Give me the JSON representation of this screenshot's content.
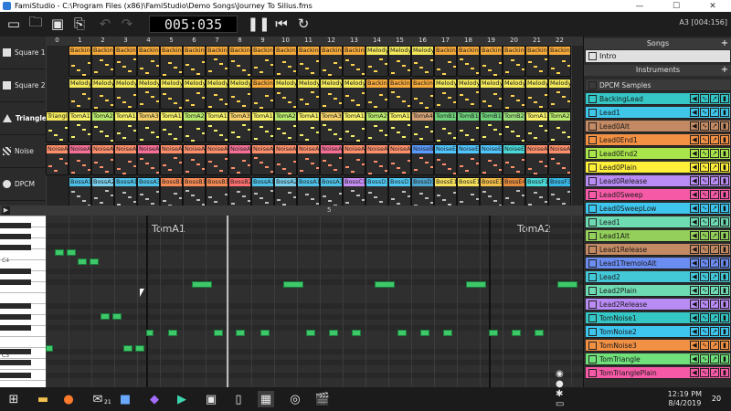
{
  "window": {
    "title": "FamiStudio - C:\\Program Files (x86)\\FamiStudio\\Demo Songs\\Journey To Silius.fms",
    "minimize": "—",
    "maximize": "☐",
    "close": "✕"
  },
  "toolbar": {
    "timecode": "005:035",
    "status": "A3 [004:156]"
  },
  "channels": [
    {
      "label": "Square 1",
      "icon": "square-wave-icon"
    },
    {
      "label": "Square 2",
      "icon": "square-wave-icon"
    },
    {
      "label": "Triangle",
      "icon": "triangle-wave-icon",
      "active": true
    },
    {
      "label": "Noise",
      "icon": "noise-icon"
    },
    {
      "label": "DPCM",
      "icon": "dpcm-icon"
    }
  ],
  "seq_numbers": [
    "0",
    "1",
    "2",
    "3",
    "4",
    "5",
    "6",
    "7",
    "8",
    "9",
    "10",
    "11",
    "12",
    "13",
    "14",
    "15",
    "16",
    "17",
    "18",
    "19",
    "20",
    "21",
    "22"
  ],
  "sequencer": {
    "square1": [
      "",
      "Backing",
      "Backing",
      "Backing",
      "Backing",
      "Backing",
      "Backing",
      "Backing",
      "Backing",
      "Backing",
      "Backing",
      "Backing",
      "Backing",
      "Backing",
      "Melody",
      "Melody",
      "Melody",
      "Backing",
      "Backing",
      "Backing",
      "Backing",
      "Backing",
      "Backing"
    ],
    "square2": [
      "",
      "Melody",
      "Melody",
      "Melody",
      "Melody",
      "Melody",
      "Melody",
      "Melody",
      "Melody",
      "Backing",
      "Melody",
      "Melody",
      "Melody",
      "Melody",
      "Backing",
      "Backing",
      "Backing",
      "Melody",
      "Melody",
      "Melody",
      "Melody",
      "Melody",
      "Melody"
    ],
    "triangle": [
      "Triangle",
      "TomA1",
      "TomA2",
      "TomA1",
      "TomA3",
      "TomA1",
      "TomA2",
      "TomA1",
      "TomA3",
      "TomA1",
      "TomA2",
      "TomA1",
      "TomA3",
      "TomA1",
      "TomA2",
      "TomA1",
      "TomA4",
      "TomB1",
      "TomB1",
      "TomB1",
      "TomB2",
      "TomA1",
      "TomA2"
    ],
    "noise": [
      "NoiseA1",
      "NoiseA2",
      "NoiseA1",
      "NoiseA1",
      "NoiseA2",
      "NoiseA1",
      "NoiseA1",
      "NoiseA1",
      "NoiseA2",
      "NoiseA1",
      "NoiseA1",
      "NoiseA1",
      "NoiseA2",
      "NoiseA1",
      "NoiseA1",
      "NoiseA1",
      "NoiseB1",
      "NoiseE1",
      "NoiseE1",
      "NoiseE1",
      "NoiseE2",
      "NoiseA1",
      "NoiseA1"
    ],
    "dpcm": [
      "",
      "BossA1",
      "BossA2",
      "BossA1",
      "BossA3",
      "BossB1",
      "BossB1",
      "BossB1",
      "BossB2",
      "BossA1",
      "BossA2",
      "BossA1",
      "BossA3",
      "BossC1",
      "BossD1",
      "BossD1",
      "BossD3",
      "BossE1",
      "BossE1",
      "BossE3",
      "BossE4",
      "BossF1",
      "BossF3"
    ]
  },
  "scroll_marker": "5",
  "piano": {
    "label_c4": "C4",
    "label_c3": "C3"
  },
  "roll": {
    "pattern_a": "TomA1",
    "pattern_b": "TomA2"
  },
  "songs": {
    "header": "Songs",
    "items": [
      "Intro"
    ]
  },
  "instruments": {
    "header": "Instruments",
    "items": [
      {
        "name": "DPCM Samples",
        "color": "#3a3a3a",
        "text": "#ddd",
        "dpcm": true
      },
      {
        "name": "BackingLead",
        "color": "#35c6c6"
      },
      {
        "name": "Lead1",
        "color": "#3fc6e8"
      },
      {
        "name": "Lead0Alt",
        "color": "#c48a63"
      },
      {
        "name": "Lead0End1",
        "color": "#f29044"
      },
      {
        "name": "Lead0End2",
        "color": "#a8e44a"
      },
      {
        "name": "Lead0Plain",
        "color": "#ffef3a"
      },
      {
        "name": "Lead0Release",
        "color": "#b98bf5"
      },
      {
        "name": "Lead0Sweep",
        "color": "#f65aa7"
      },
      {
        "name": "Lead0SweepLow",
        "color": "#3ec6ef"
      },
      {
        "name": "Lead1",
        "color": "#6fdbb3"
      },
      {
        "name": "Lead1Alt",
        "color": "#93cf5a"
      },
      {
        "name": "Lead1Release",
        "color": "#c48a63"
      },
      {
        "name": "Lead1TremoloAlt",
        "color": "#6b8cf0"
      },
      {
        "name": "Lead2",
        "color": "#43c8d8"
      },
      {
        "name": "Lead2Plain",
        "color": "#6fdbb3"
      },
      {
        "name": "Lead2Release",
        "color": "#b98bf5"
      },
      {
        "name": "TomNoise1",
        "color": "#35c6c6"
      },
      {
        "name": "TomNoise2",
        "color": "#3ec6ef"
      },
      {
        "name": "TomNoise3",
        "color": "#f29044"
      },
      {
        "name": "TomTriangle",
        "color": "#6fe07a"
      },
      {
        "name": "TomTrianglePlain",
        "color": "#f65aa7"
      }
    ]
  },
  "taskbar": {
    "time": "12:19 PM",
    "date": "8/4/2019",
    "badge": "20",
    "mail_badge": "21"
  }
}
